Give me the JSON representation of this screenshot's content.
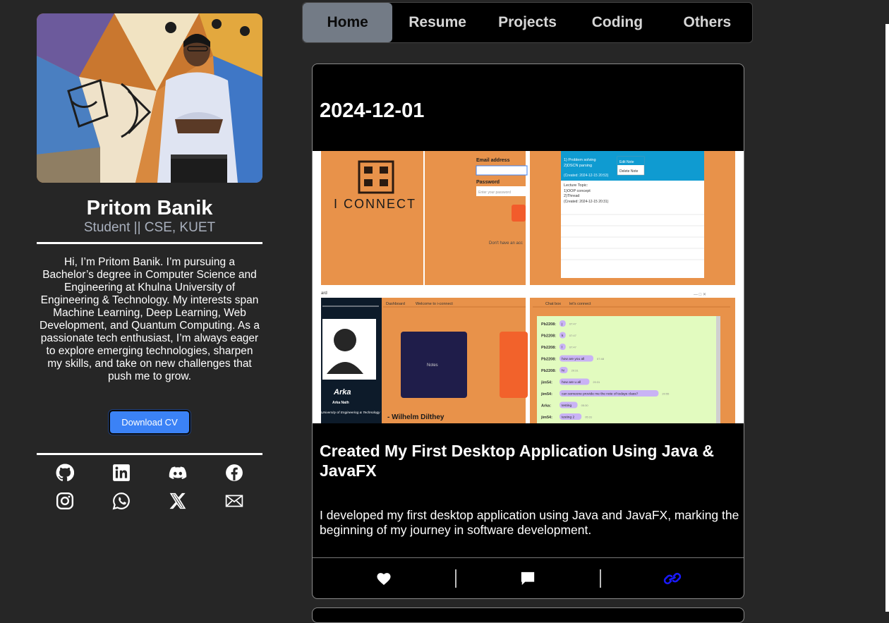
{
  "profile": {
    "name": "Pritom Banik",
    "subtitle": "Student || CSE, KUET",
    "bio": "Hi, I’m Pritom Banik. I’m pursuing a Bachelor’s degree in Computer Science and Engineering at Khulna University of Engineering & Technology. My interests span Machine Learning, Deep Learning, Web Development, and Quantum Computing. As a passionate tech enthusiast, I’m always eager to explore emerging technologies, sharpen my skills, and take on new challenges that push me to grow.",
    "cv_label": "Download CV"
  },
  "socials": [
    {
      "icon": "github-icon"
    },
    {
      "icon": "linkedin-icon"
    },
    {
      "icon": "discord-icon"
    },
    {
      "icon": "facebook-icon"
    },
    {
      "icon": "instagram-icon"
    },
    {
      "icon": "whatsapp-icon"
    },
    {
      "icon": "x-icon"
    },
    {
      "icon": "mail-icon"
    }
  ],
  "nav": {
    "items": [
      {
        "label": "Home",
        "active": true
      },
      {
        "label": "Resume"
      },
      {
        "label": "Projects"
      },
      {
        "label": "Coding"
      },
      {
        "label": "Others"
      }
    ]
  },
  "post": {
    "date": "2024-12-01",
    "title": "Created My First Desktop Application Using Java & JavaFX",
    "description": "I developed my first desktop application using Java and JavaFX, marking the beginning of my journey in software development.",
    "screenshot": {
      "logo_text": "I CONNECT",
      "email_label": "Email address",
      "password_label": "Password",
      "password_placeholder": "Enter your password",
      "signup_hint": "Don't have an acc",
      "note_1": "1) Problem solving",
      "note_2": "2)DSCN parsing",
      "note_created_1": "(Created: 2024-12-15 20:53)",
      "edit_note": "Edit Note",
      "delete_note": "Delete Note",
      "lecture_topic": "Lecture Topic:",
      "lecture_1": "1)OOP concept",
      "lecture_2": "2)Thread",
      "note_created_2": "(Created: 2024-12-15 20:31)",
      "tab_dashboard": "Dashboard",
      "tab_welcome": "Welcome to i-connect",
      "user_name": "Arka",
      "user_fullname": "Arka Nath",
      "user_uni": "University of Engineering & Technology",
      "notes_card": "Notes",
      "quote": "- Wilhelm Dilthey",
      "window_title": "ard",
      "chat_tab": "Chat box",
      "connect_tab": "let's connect",
      "chat": [
        {
          "user": "Pb2208:",
          "msg": "j",
          "time": "07:47"
        },
        {
          "user": "Pb2208:",
          "msg": "k",
          "time": "07:47"
        },
        {
          "user": "Pb2208:",
          "msg": "l",
          "time": "07:47"
        },
        {
          "user": "Pb2208:",
          "msg": "how are you all",
          "time": "07:48"
        },
        {
          "user": "Pb2208:",
          "msg": "hi",
          "time": "20:31"
        },
        {
          "user": "jim54:",
          "msg": "how are u all",
          "time": "20:31"
        },
        {
          "user": "jim54:",
          "msg": "can someone provide me the note of todays class?",
          "time": "20:55"
        },
        {
          "user": "Arka:",
          "msg": "testing",
          "time": "05:30"
        },
        {
          "user": "jim54:",
          "msg": "testing 2",
          "time": "05:31"
        }
      ]
    }
  },
  "colors": {
    "page_bg": "#262626",
    "nav_active": "#737b86",
    "cv_button": "#3b82f6",
    "link_icon": "#1a1aff",
    "screenshot_orange": "#e8924a"
  }
}
